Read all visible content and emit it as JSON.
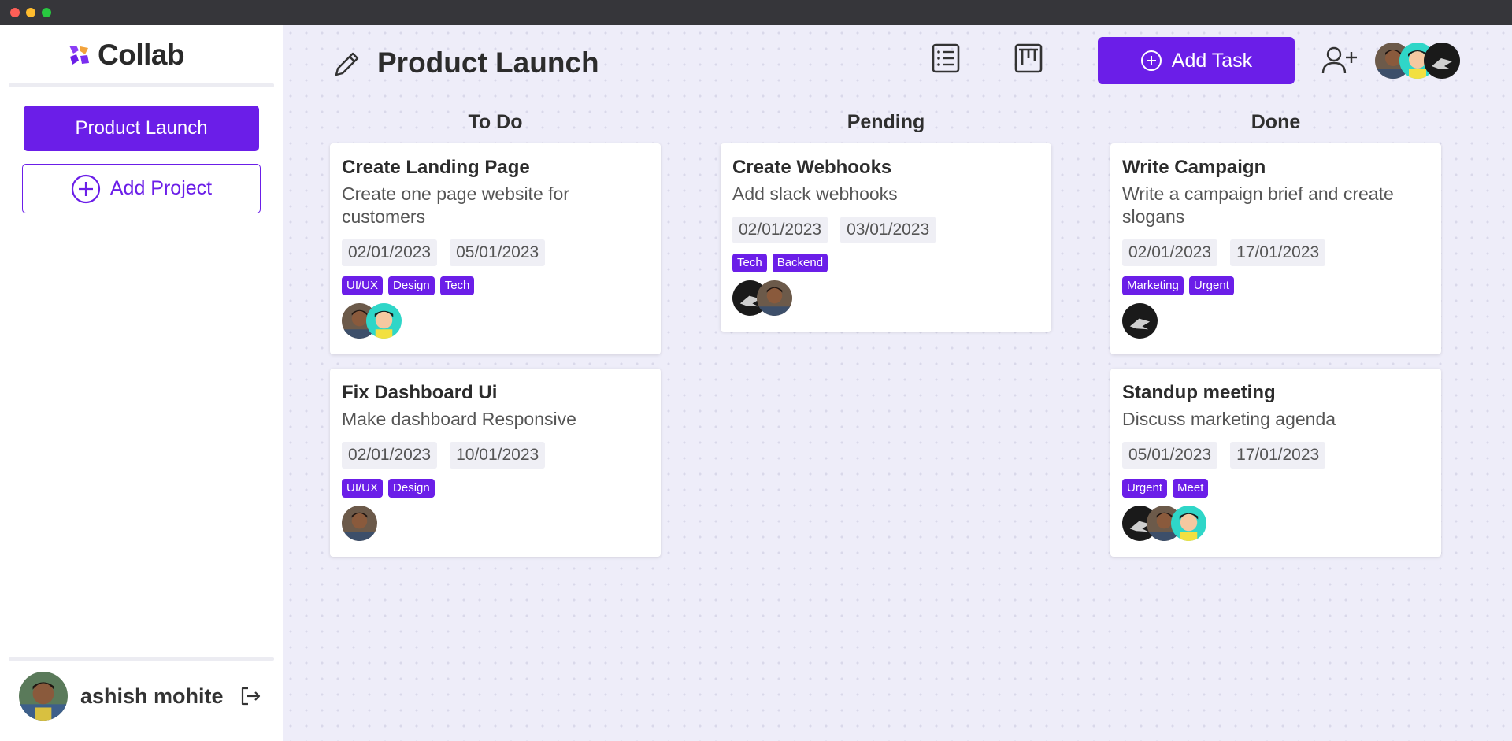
{
  "app": {
    "brand": "Collab",
    "accent": "#6b1ee8",
    "background": "#eeedf9"
  },
  "sidebar": {
    "projects": [
      {
        "label": "Product Launch"
      }
    ],
    "add_project_label": "Add Project",
    "user": {
      "name": "ashish mohite"
    }
  },
  "header": {
    "title": "Product Launch",
    "add_task_label": "Add Task",
    "icons": [
      "pencil-icon",
      "list-view-icon",
      "board-view-icon",
      "add-user-icon"
    ],
    "team": [
      "avatar-man-photo",
      "avatar-cartoon",
      "avatar-dark-dragon"
    ]
  },
  "board": {
    "columns": [
      {
        "title": "To Do",
        "cards": [
          {
            "title": "Create Landing Page",
            "description": "Create one page website for customers",
            "start": "02/01/2023",
            "end": "05/01/2023",
            "tags": [
              "UI/UX",
              "Design",
              "Tech"
            ],
            "assignees": [
              "photo",
              "cartoon"
            ]
          },
          {
            "title": "Fix Dashboard Ui",
            "description": "Make dashboard Responsive",
            "start": "02/01/2023",
            "end": "10/01/2023",
            "tags": [
              "UI/UX",
              "Design"
            ],
            "assignees": [
              "photo"
            ]
          }
        ]
      },
      {
        "title": "Pending",
        "cards": [
          {
            "title": "Create Webhooks",
            "description": "Add slack webhooks",
            "start": "02/01/2023",
            "end": "03/01/2023",
            "tags": [
              "Tech",
              "Backend"
            ],
            "assignees": [
              "dragon",
              "photo"
            ]
          }
        ]
      },
      {
        "title": "Done",
        "cards": [
          {
            "title": "Write Campaign",
            "description": "Write a campaign brief and create slogans",
            "start": "02/01/2023",
            "end": "17/01/2023",
            "tags": [
              "Marketing",
              "Urgent"
            ],
            "assignees": [
              "dragon"
            ]
          },
          {
            "title": "Standup meeting",
            "description": "Discuss marketing agenda",
            "start": "05/01/2023",
            "end": "17/01/2023",
            "tags": [
              "Urgent",
              "Meet"
            ],
            "assignees": [
              "dragon",
              "photo",
              "cartoon"
            ]
          }
        ]
      }
    ]
  }
}
